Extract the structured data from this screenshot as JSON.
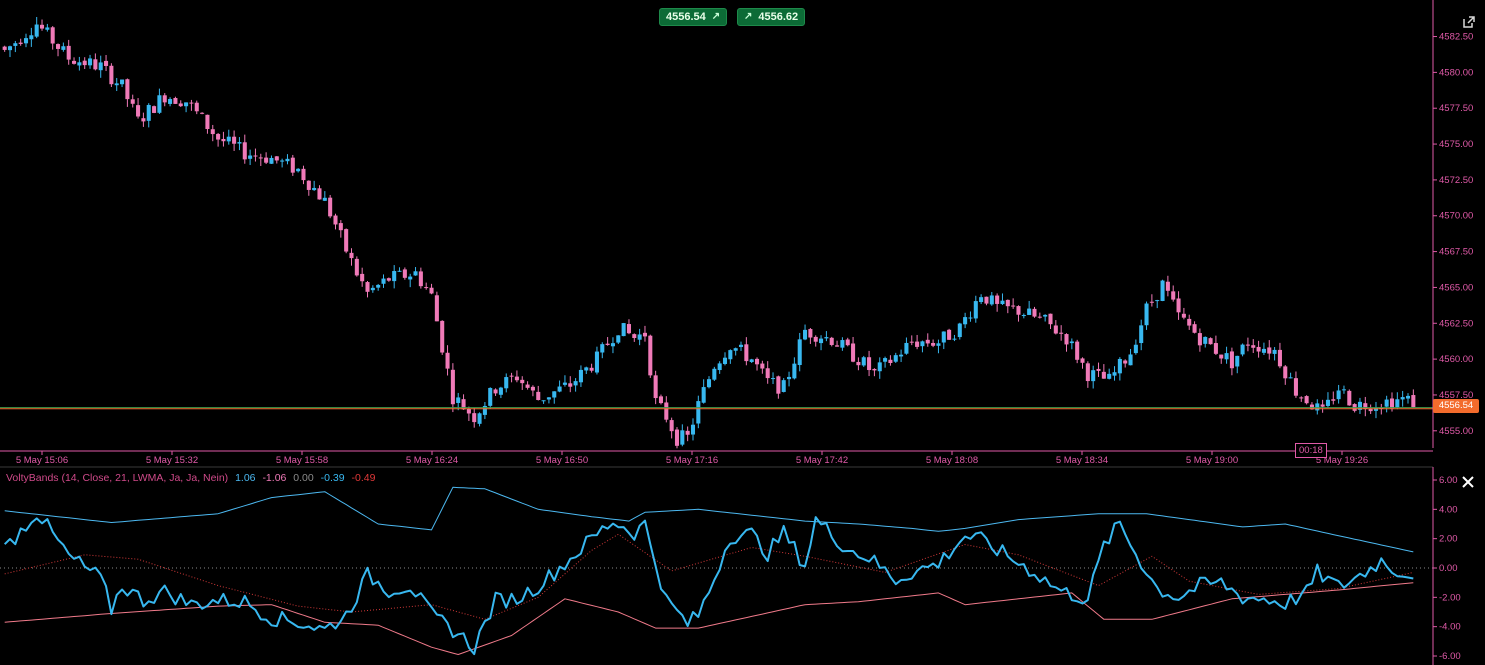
{
  "header": {
    "bid_label": "4556.54",
    "ask_label": "4556.62",
    "bid_arrow": "↗",
    "ask_arrow": "↗"
  },
  "current_price_tag": "4556.54",
  "bar_timer": "00:18",
  "indicator_legend": {
    "name": "VoltyBands (14, Close, 21, LWMA, Ja, Ja, Nein)",
    "v1": "1.06",
    "v2": "-1.06",
    "v3": "0.00",
    "v4": "-0.39",
    "v5": "-0.49"
  },
  "colors": {
    "bull": "#38b8f0",
    "bear": "#f07ab8",
    "axis": "#e05aa8",
    "band": "#4cb8f0",
    "signal": "#38b8f0",
    "lower_band": "#f07a8a",
    "mid_dotted": "#d03838",
    "price_line_green": "#3b9c4c",
    "price_line_orange": "#f36b2c"
  },
  "icons": {
    "popout": "popout-icon",
    "close": "close-icon"
  },
  "chart_data": [
    {
      "type": "candlestick",
      "title": "",
      "x_tick_labels": [
        "5 May 15:06",
        "5 May 15:32",
        "5 May 15:58",
        "5 May 16:24",
        "5 May 16:50",
        "5 May 17:16",
        "5 May 17:42",
        "5 May 18:08",
        "5 May 18:34",
        "5 May 19:00",
        "5 May 19:26"
      ],
      "y_tick_labels": [
        "4582.50",
        "4580.00",
        "4577.50",
        "4575.00",
        "4572.50",
        "4570.00",
        "4567.50",
        "4565.00",
        "4562.50",
        "4560.00",
        "4557.50",
        "4555.00"
      ],
      "ylim": [
        4553.8,
        4584.7
      ],
      "current_price": 4556.54,
      "ask_price": 4556.62,
      "close_path": [
        [
          0,
          4581.5
        ],
        [
          6,
          4583.4
        ],
        [
          12,
          4581.0
        ],
        [
          18,
          4580.4
        ],
        [
          22,
          4579.0
        ],
        [
          25,
          4576.6
        ],
        [
          30,
          4578.4
        ],
        [
          34,
          4578.0
        ],
        [
          40,
          4575.4
        ],
        [
          45,
          4574.4
        ],
        [
          50,
          4574.0
        ],
        [
          55,
          4573.2
        ],
        [
          60,
          4571.0
        ],
        [
          62,
          4569.4
        ],
        [
          64,
          4567.6
        ],
        [
          66,
          4566.0
        ],
        [
          68,
          4564.6
        ],
        [
          72,
          4565.6
        ],
        [
          77,
          4566.0
        ],
        [
          80,
          4564.4
        ],
        [
          84,
          4557.4
        ],
        [
          88,
          4556.0
        ],
        [
          92,
          4558.0
        ],
        [
          96,
          4558.8
        ],
        [
          100,
          4557.2
        ],
        [
          106,
          4558.2
        ],
        [
          111,
          4560.0
        ],
        [
          115,
          4562.2
        ],
        [
          118,
          4561.5
        ],
        [
          120,
          4561.8
        ],
        [
          122,
          4557.0
        ],
        [
          124,
          4556.0
        ],
        [
          126,
          4554.5
        ],
        [
          128,
          4554.5
        ],
        [
          130,
          4556.8
        ],
        [
          133,
          4559.6
        ],
        [
          136,
          4561.0
        ],
        [
          140,
          4560.0
        ],
        [
          143,
          4558.4
        ],
        [
          146,
          4558.0
        ],
        [
          150,
          4562.0
        ],
        [
          155,
          4561.4
        ],
        [
          160,
          4560.0
        ],
        [
          163,
          4559.0
        ],
        [
          167,
          4560.2
        ],
        [
          170,
          4561.2
        ],
        [
          175,
          4561.2
        ],
        [
          179,
          4562.2
        ],
        [
          183,
          4564.6
        ],
        [
          186,
          4563.6
        ],
        [
          190,
          4563.4
        ],
        [
          195,
          4562.6
        ],
        [
          199,
          4561.5
        ],
        [
          203,
          4559.0
        ],
        [
          207,
          4558.5
        ],
        [
          211,
          4560.5
        ],
        [
          214,
          4563.5
        ],
        [
          217,
          4565.2
        ],
        [
          220,
          4563.0
        ],
        [
          224,
          4561.5
        ],
        [
          230,
          4559.8
        ],
        [
          233,
          4561.2
        ],
        [
          238,
          4560.6
        ],
        [
          242,
          4557.8
        ],
        [
          247,
          4556.2
        ],
        [
          250,
          4558.0
        ],
        [
          253,
          4556.8
        ],
        [
          258,
          4557.0
        ],
        [
          262,
          4557.2
        ],
        [
          264,
          4557.0
        ]
      ],
      "note": "close_path is [bar_index, close] anchor points (bar_index counts from the left, 265 bars total); the bars are drawn by interpolating between them"
    },
    {
      "type": "line",
      "title": "VoltyBands (14, Close, 21, LWMA, Ja, Ja, Nein)",
      "y_tick_labels": [
        "6.00",
        "4.00",
        "2.00",
        "0.00",
        "-2.00",
        "-4.00",
        "-6.00"
      ],
      "ylim": [
        -6.0,
        6.0
      ],
      "series": [
        {
          "name": "",
          "role": "upper_band",
          "values_path": [
            [
              0,
              3.9
            ],
            [
              20,
              3.1
            ],
            [
              40,
              3.7
            ],
            [
              50,
              4.8
            ],
            [
              60,
              5.2
            ],
            [
              70,
              3.0
            ],
            [
              80,
              2.6
            ],
            [
              84,
              5.5
            ],
            [
              90,
              5.4
            ],
            [
              100,
              4.0
            ],
            [
              110,
              3.5
            ],
            [
              117,
              3.2
            ],
            [
              120,
              3.8
            ],
            [
              130,
              4.0
            ],
            [
              140,
              3.6
            ],
            [
              150,
              3.2
            ],
            [
              160,
              3.0
            ],
            [
              170,
              2.7
            ],
            [
              175,
              2.5
            ],
            [
              180,
              2.7
            ],
            [
              190,
              3.3
            ],
            [
              205,
              3.7
            ],
            [
              214,
              3.7
            ],
            [
              222,
              3.3
            ],
            [
              232,
              2.8
            ],
            [
              240,
              3.0
            ],
            [
              250,
              2.2
            ],
            [
              264,
              1.1
            ]
          ]
        },
        {
          "name": "",
          "role": "lower_band",
          "values_path": [
            [
              0,
              -3.7
            ],
            [
              20,
              -3.1
            ],
            [
              40,
              -2.6
            ],
            [
              50,
              -2.5
            ],
            [
              60,
              -3.7
            ],
            [
              70,
              -3.9
            ],
            [
              80,
              -5.4
            ],
            [
              85,
              -5.9
            ],
            [
              95,
              -4.6
            ],
            [
              105,
              -2.1
            ],
            [
              115,
              -3.0
            ],
            [
              122,
              -4.1
            ],
            [
              130,
              -4.1
            ],
            [
              150,
              -2.5
            ],
            [
              160,
              -2.3
            ],
            [
              175,
              -1.7
            ],
            [
              180,
              -2.5
            ],
            [
              200,
              -1.7
            ],
            [
              206,
              -3.5
            ],
            [
              215,
              -3.5
            ],
            [
              230,
              -2.1
            ],
            [
              240,
              -1.8
            ],
            [
              250,
              -1.5
            ],
            [
              264,
              -1.0
            ]
          ]
        },
        {
          "name": "",
          "role": "mid_dotted",
          "values_path": [
            [
              0,
              -0.4
            ],
            [
              15,
              0.9
            ],
            [
              25,
              0.6
            ],
            [
              40,
              -1.2
            ],
            [
              55,
              -2.6
            ],
            [
              65,
              -3.0
            ],
            [
              80,
              -2.5
            ],
            [
              90,
              -3.5
            ],
            [
              100,
              -2.0
            ],
            [
              110,
              1.2
            ],
            [
              115,
              2.3
            ],
            [
              125,
              -0.2
            ],
            [
              140,
              1.4
            ],
            [
              150,
              0.8
            ],
            [
              165,
              -0.3
            ],
            [
              180,
              1.6
            ],
            [
              190,
              0.9
            ],
            [
              205,
              -1.2
            ],
            [
              215,
              0.8
            ],
            [
              222,
              -0.9
            ],
            [
              235,
              -1.8
            ],
            [
              250,
              -1.4
            ],
            [
              264,
              -0.3
            ]
          ]
        },
        {
          "name": "",
          "role": "signal",
          "values_path": [
            [
              0,
              1.3
            ],
            [
              6,
              3.8
            ],
            [
              12,
              0.8
            ],
            [
              18,
              -0.7
            ],
            [
              20,
              -2.8
            ],
            [
              22,
              -1.2
            ],
            [
              26,
              -2.2
            ],
            [
              30,
              -1.6
            ],
            [
              35,
              -2.5
            ],
            [
              40,
              -2.2
            ],
            [
              45,
              -2.3
            ],
            [
              50,
              -3.4
            ],
            [
              55,
              -3.7
            ],
            [
              60,
              -4.2
            ],
            [
              64,
              -3.2
            ],
            [
              68,
              -0.5
            ],
            [
              72,
              -1.5
            ],
            [
              76,
              -1.2
            ],
            [
              80,
              -3.2
            ],
            [
              84,
              -4.2
            ],
            [
              88,
              -5.4
            ],
            [
              92,
              -2.2
            ],
            [
              96,
              -2.1
            ],
            [
              100,
              -1.2
            ],
            [
              105,
              0.3
            ],
            [
              110,
              2.0
            ],
            [
              114,
              3.2
            ],
            [
              118,
              2.4
            ],
            [
              120,
              3.0
            ],
            [
              124,
              -2.2
            ],
            [
              128,
              -3.8
            ],
            [
              130,
              -3.2
            ],
            [
              132,
              -1.6
            ],
            [
              136,
              2.2
            ],
            [
              140,
              2.3
            ],
            [
              143,
              1.0
            ],
            [
              146,
              2.4
            ],
            [
              150,
              0.2
            ],
            [
              152,
              3.3
            ],
            [
              158,
              1.3
            ],
            [
              162,
              0.7
            ],
            [
              167,
              -0.8
            ],
            [
              170,
              -0.3
            ],
            [
              175,
              0.3
            ],
            [
              180,
              2.2
            ],
            [
              183,
              1.9
            ],
            [
              188,
              0.8
            ],
            [
              193,
              -0.3
            ],
            [
              198,
              -1.6
            ],
            [
              203,
              -2.1
            ],
            [
              206,
              1.5
            ],
            [
              209,
              3.0
            ],
            [
              212,
              1.0
            ],
            [
              216,
              -1.4
            ],
            [
              220,
              -2.0
            ],
            [
              224,
              -1.2
            ],
            [
              228,
              -1.0
            ],
            [
              232,
              -2.0
            ],
            [
              236,
              -2.1
            ],
            [
              240,
              -2.4
            ],
            [
              244,
              -1.7
            ],
            [
              246,
              -0.3
            ],
            [
              250,
              -1.3
            ],
            [
              254,
              -0.5
            ],
            [
              258,
              0.5
            ],
            [
              262,
              -0.4
            ],
            [
              264,
              -0.3
            ]
          ]
        }
      ]
    }
  ]
}
